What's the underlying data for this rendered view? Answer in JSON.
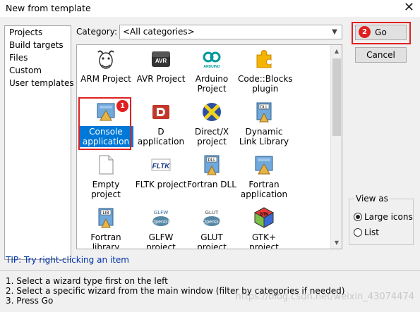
{
  "window": {
    "title": "New from template",
    "close_glyph": "✕"
  },
  "sidebar": {
    "items": [
      {
        "label": "Projects"
      },
      {
        "label": "Build targets"
      },
      {
        "label": "Files"
      },
      {
        "label": "Custom"
      },
      {
        "label": "User templates"
      }
    ]
  },
  "category": {
    "label": "Category:",
    "value": "<All categories>"
  },
  "templates": [
    {
      "label": "ARM Project",
      "icon": "gnu-icon"
    },
    {
      "label": "AVR Project",
      "icon": "avr-icon"
    },
    {
      "label": "Arduino Project",
      "icon": "arduino-icon"
    },
    {
      "label": "Code::Blocks plugin",
      "icon": "puzzle-icon"
    },
    {
      "label": "Console application",
      "icon": "console-icon",
      "selected": true
    },
    {
      "label": "D application",
      "icon": "d-icon"
    },
    {
      "label": "Direct/X project",
      "icon": "directx-icon"
    },
    {
      "label": "Dynamic Link Library",
      "icon": "dll-icon"
    },
    {
      "label": "Empty project",
      "icon": "empty-file-icon"
    },
    {
      "label": "FLTK project",
      "icon": "fltk-icon"
    },
    {
      "label": "Fortran DLL",
      "icon": "fortran-dll-icon"
    },
    {
      "label": "Fortran application",
      "icon": "fortran-app-icon"
    },
    {
      "label": "Fortran library",
      "icon": "lib-icon"
    },
    {
      "label": "GLFW project",
      "icon": "glfw-icon"
    },
    {
      "label": "GLUT project",
      "icon": "glut-icon"
    },
    {
      "label": "GTK+ project",
      "icon": "gtk-icon"
    }
  ],
  "icon_text": {
    "avr": "AVR",
    "arduino": "ARDUINO",
    "dll": "DLL",
    "fltk": "FLTK",
    "lib": "LIB",
    "glfw": "GLFW",
    "glut": "GLUT",
    "opengl": "OpenGL",
    "gtk": "GTK"
  },
  "tip": "TIP: Try right-clicking an item",
  "steps": [
    "1. Select a wizard type first on the left",
    "2. Select a specific wizard from the main window (filter by categories if needed)",
    "3. Press Go"
  ],
  "buttons": {
    "go": "Go",
    "cancel": "Cancel"
  },
  "view_as": {
    "legend": "View as",
    "options": [
      {
        "label": "Large icons",
        "checked": true
      },
      {
        "label": "List",
        "checked": false
      }
    ]
  },
  "annotations": {
    "badge1": "1",
    "badge2": "2",
    "color": "#e02020"
  },
  "watermark": "https://blog.csdn.net/weixin_43074474"
}
